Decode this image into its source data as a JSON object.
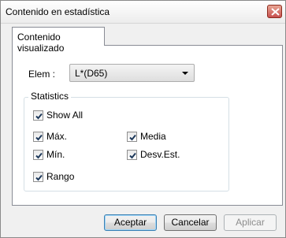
{
  "window": {
    "title": "Contenido en estadística"
  },
  "tabs": [
    {
      "label": "Contenido visualizado"
    }
  ],
  "elem": {
    "label": "Elem :",
    "selected": "L*(D65)"
  },
  "statistics": {
    "legend": "Statistics",
    "show_all": {
      "label": "Show All",
      "checked": true
    },
    "items": [
      {
        "label": "Máx.",
        "checked": true
      },
      {
        "label": "Media",
        "checked": true
      },
      {
        "label": "Mín.",
        "checked": true
      },
      {
        "label": "Desv.Est.",
        "checked": true
      },
      {
        "label": "Rango",
        "checked": true
      }
    ]
  },
  "buttons": {
    "ok": "Aceptar",
    "cancel": "Cancelar",
    "apply": "Aplicar"
  }
}
